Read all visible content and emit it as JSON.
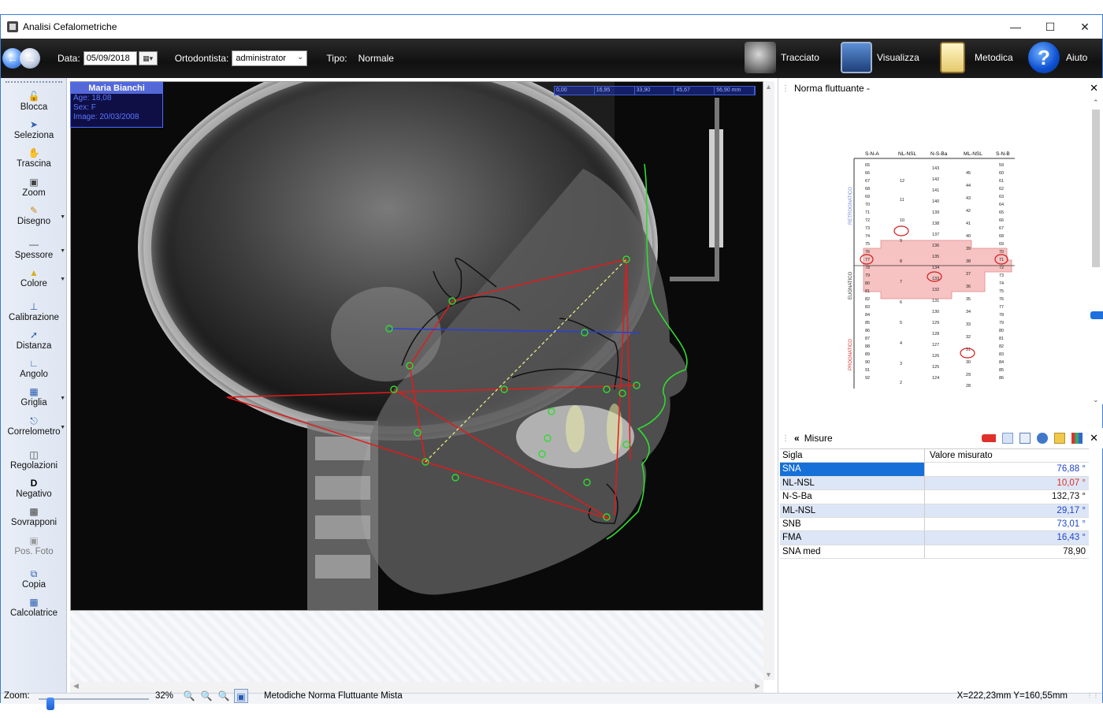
{
  "window": {
    "title": "Analisi Cefalometriche",
    "controls": {
      "minimize": "—",
      "maximize": "☐",
      "close": "✕"
    }
  },
  "toolbar": {
    "date_label": "Data:",
    "date_value": "05/09/2018",
    "ortho_label": "Ortodontista:",
    "ortho_value": "administrator",
    "tipo_label": "Tipo:",
    "tipo_value": "Normale",
    "tools": [
      {
        "label": "Tracciato",
        "icon": "skull-tracing-icon"
      },
      {
        "label": "Visualizza",
        "icon": "monitor-skull-icon"
      },
      {
        "label": "Metodica",
        "icon": "clipboard-checklist-icon"
      },
      {
        "label": "Aiuto",
        "icon": "help-icon"
      }
    ]
  },
  "left_tools": [
    {
      "label": "Blocca",
      "icon": "lock-icon"
    },
    {
      "label": "Seleziona",
      "icon": "cursor-icon"
    },
    {
      "label": "Trascina",
      "icon": "hand-icon"
    },
    {
      "label": "Zoom",
      "icon": "zoom-icon"
    },
    {
      "label": "Disegno",
      "icon": "pencil-icon"
    },
    {
      "label": "Spessore",
      "icon": "line-thickness-icon"
    },
    {
      "label": "Colore",
      "icon": "color-icon"
    },
    {
      "label": "Calibrazione",
      "icon": "calibration-icon"
    },
    {
      "label": "Distanza",
      "icon": "distance-icon"
    },
    {
      "label": "Angolo",
      "icon": "angle-icon"
    },
    {
      "label": "Griglia",
      "icon": "grid-icon"
    },
    {
      "label": "Correlometro",
      "icon": "correlometer-icon"
    },
    {
      "label": "Regolazioni",
      "icon": "adjustments-icon"
    },
    {
      "label": "Negativo",
      "icon": "negative-icon"
    },
    {
      "label": "Sovrapponi",
      "icon": "overlay-icon"
    },
    {
      "label": "Pos. Foto",
      "icon": "photo-position-icon"
    },
    {
      "label": "Copia",
      "icon": "copy-icon"
    },
    {
      "label": "Calcolatrice",
      "icon": "calculator-icon"
    }
  ],
  "patient": {
    "name": "Maria Bianchi",
    "age": "Age: 18,08",
    "sex": "Sex: F",
    "image_date": "Image: 20/03/2008"
  },
  "ruler": [
    "0,00",
    "16,95",
    "33,90",
    "45,67",
    "56,90 mm"
  ],
  "norma_panel": {
    "title": "Norma fluttuante  -",
    "chart_headers": [
      "S-N-A",
      "NL-NSL",
      "N-S-Ba",
      "ML-NSL",
      "S-N-B"
    ],
    "side_labels": [
      "RETROGNATICO",
      "EUGNATICO",
      "PROGNATICO"
    ]
  },
  "misure_panel": {
    "title": "Misure",
    "columns": [
      "Sigla",
      "Valore misurato"
    ],
    "rows": [
      {
        "sigla": "SNA",
        "valore": "76,88 °",
        "color": "#1f46c8"
      },
      {
        "sigla": "NL-NSL",
        "valore": "10,07 °",
        "color": "#e0301e"
      },
      {
        "sigla": "N-S-Ba",
        "valore": "132,73 °",
        "color": "#111111"
      },
      {
        "sigla": "ML-NSL",
        "valore": "29,17 °",
        "color": "#1f46c8"
      },
      {
        "sigla": "SNB",
        "valore": "73,01 °",
        "color": "#1f46c8"
      },
      {
        "sigla": "FMA",
        "valore": "16,43 °",
        "color": "#1f46c8"
      },
      {
        "sigla": "SNA med",
        "valore": "78,90",
        "color": "#111111"
      }
    ]
  },
  "status": {
    "zoom_label": "Zoom:",
    "zoom_value": 32,
    "zoom_pct": "32%",
    "metodiche": "Metodiche  Norma Fluttuante Mista",
    "coords": "X=222,23mm Y=160,55mm"
  },
  "colors": {
    "accent": "#1670d8",
    "tracing_red": "#e21b1b",
    "tracing_green": "#2fdc2f",
    "tracing_blue": "#2a3fd8",
    "tracing_yellow": "#f2f28a"
  }
}
